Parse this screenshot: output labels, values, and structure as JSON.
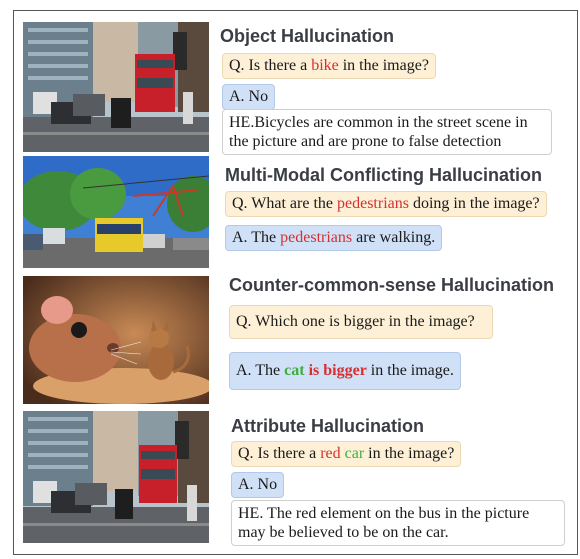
{
  "sections": [
    {
      "title": "Object Hallucination",
      "question": {
        "prefix": "Q. Is there a ",
        "highlight": "bike",
        "suffix": " in the image?"
      },
      "answer": "A. No",
      "explanation": "HE.Bicycles are common in the street scene in the picture and are prone to false detection"
    },
    {
      "title": "Multi-Modal Conflicting Hallucination",
      "question": {
        "prefix": "Q. What are the ",
        "highlight": "pedestrians",
        "suffix": " doing in the image?"
      },
      "answer": {
        "prefix": "A. The ",
        "highlight": "pedestrians",
        "suffix": " are walking."
      }
    },
    {
      "title": "Counter-common-sense Hallucination",
      "question": "Q. Which one is bigger in the image?",
      "answer": {
        "prefix": "A. The ",
        "green": "cat",
        "space": " ",
        "bold_red": "is bigger",
        "suffix": " in the image."
      }
    },
    {
      "title": "Attribute Hallucination",
      "question": {
        "prefix": "Q. Is there a ",
        "red": "red",
        "space": " ",
        "green": "car",
        "suffix": " in the image?"
      },
      "answer": "A. No",
      "explanation": "HE. The red element on the bus in the picture may be believed to be on the car."
    }
  ],
  "colors": {
    "highlight_red": "#d63030",
    "highlight_green": "#3fae3f",
    "question_bg": "#fdf0d7",
    "answer_bg": "#cfe0f7",
    "title": "#3a3d44"
  }
}
